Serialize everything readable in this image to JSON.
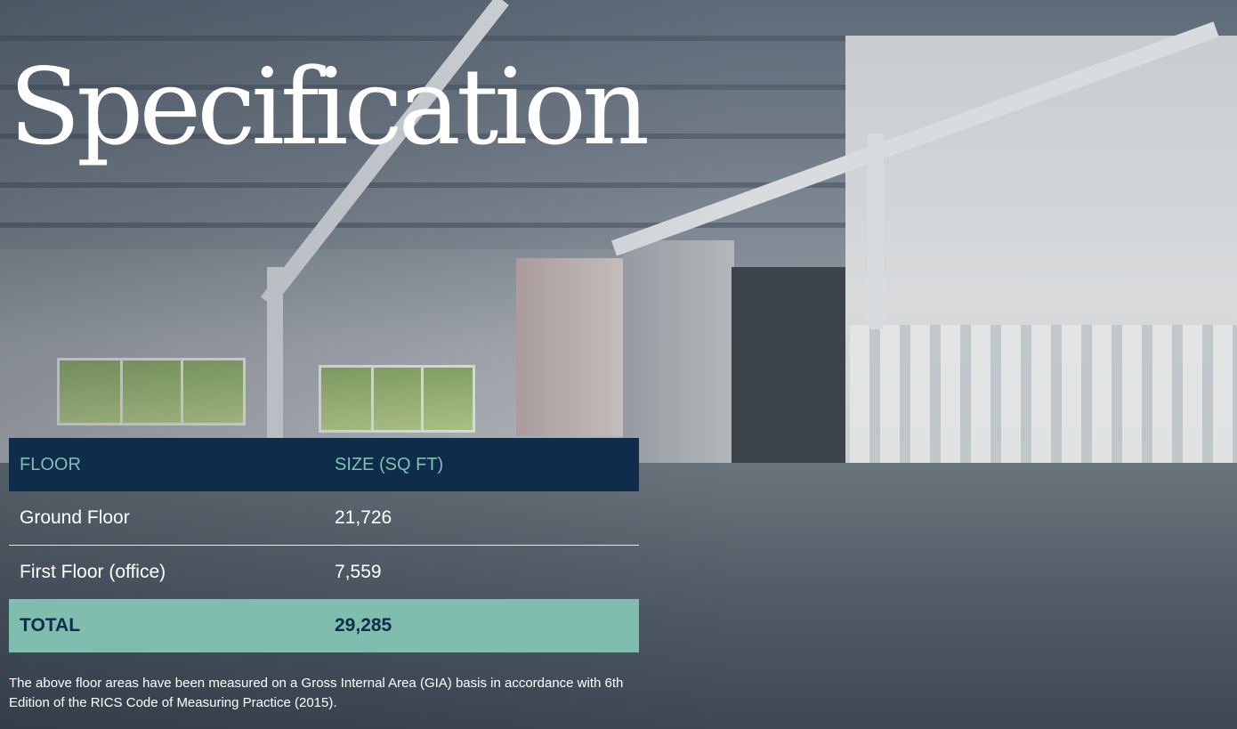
{
  "page": {
    "title": "Specification"
  },
  "table": {
    "headers": [
      "FLOOR",
      "SIZE (SQ FT)"
    ],
    "rows": [
      {
        "floor": "Ground Floor",
        "size": "21,726"
      },
      {
        "floor": "First Floor (office)",
        "size": "7,559"
      }
    ],
    "total": {
      "label": "TOTAL",
      "size": "29,285"
    }
  },
  "note": "The above floor areas have been measured on a Gross Internal Area (GIA) basis in accordance with 6th Edition of the RICS Code of Measuring Practice (2015).",
  "colors": {
    "header_bg": "#0f2c4a",
    "header_text": "#7fc0b2",
    "total_bg": "#7fbdae",
    "total_text": "#0f2c4a"
  }
}
